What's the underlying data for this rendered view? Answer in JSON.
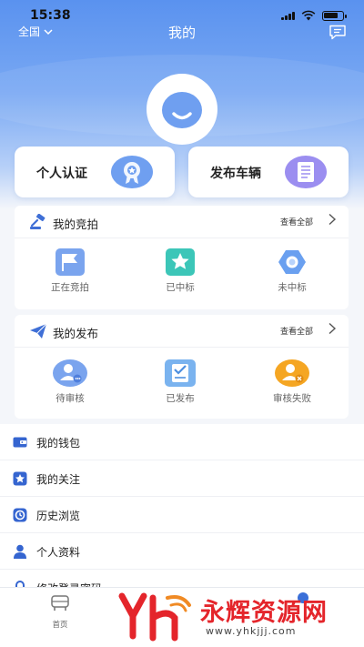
{
  "status_bar": {
    "time": "15:38"
  },
  "header": {
    "region": "全国",
    "title": "我的"
  },
  "cards": [
    {
      "label": "个人认证",
      "icon": "certificate-badge-icon"
    },
    {
      "label": "发布车辆",
      "icon": "document-list-icon"
    }
  ],
  "auction": {
    "title": "我的竞拍",
    "view_all": "查看全部",
    "items": [
      {
        "label": "正在竞拍",
        "icon": "flag-icon"
      },
      {
        "label": "已中标",
        "icon": "star-icon"
      },
      {
        "label": "未中标",
        "icon": "hexagon-icon"
      }
    ]
  },
  "publish": {
    "title": "我的发布",
    "view_all": "查看全部",
    "items": [
      {
        "label": "待审核",
        "icon": "user-pending-icon"
      },
      {
        "label": "已发布",
        "icon": "checklist-icon"
      },
      {
        "label": "审核失败",
        "icon": "user-rejected-icon"
      }
    ]
  },
  "menu": [
    {
      "label": "我的钱包",
      "icon": "wallet-icon"
    },
    {
      "label": "我的关注",
      "icon": "star-icon"
    },
    {
      "label": "历史浏览",
      "icon": "history-icon"
    },
    {
      "label": "个人资料",
      "icon": "person-icon"
    },
    {
      "label": "修改登录密码",
      "icon": "lock-icon"
    }
  ],
  "tabbar": {
    "home": "首页"
  },
  "watermark": {
    "text": "永辉资源网",
    "url": "www.yhkjjj.com"
  },
  "colors": {
    "primary": "#5a92ef",
    "accent_orange": "#f5a623",
    "watermark_red": "#e4252b"
  }
}
